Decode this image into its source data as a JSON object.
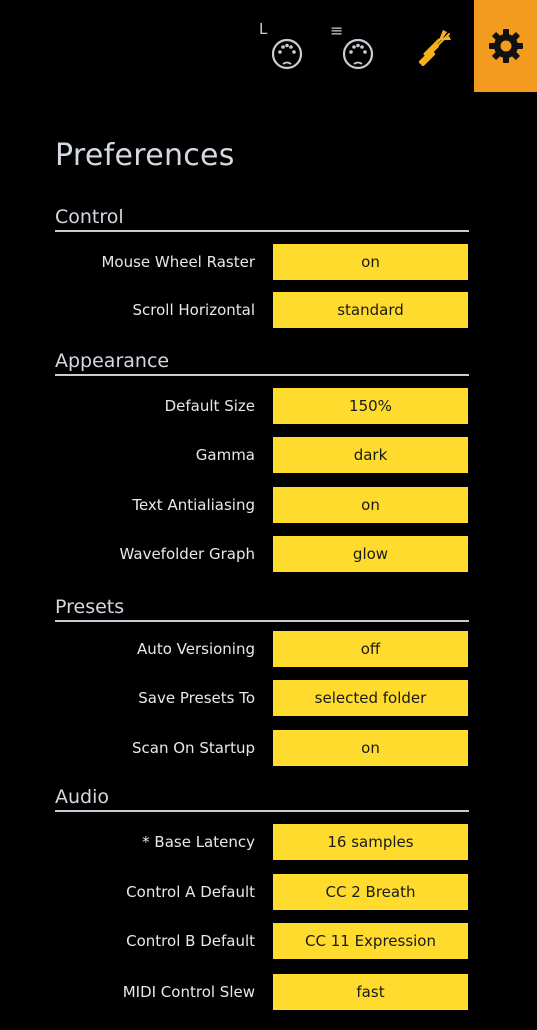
{
  "toolbar": {
    "midi_l_mark": "L",
    "midi_e_mark": "≡",
    "icons": [
      "midi-din-icon",
      "midi-din-icon",
      "tools-icon",
      "gear-icon"
    ],
    "active_color": "#f29b1f",
    "icon_color": "#c9cdd3",
    "tools_color": "#f5b21c"
  },
  "page": {
    "title": "Preferences"
  },
  "theme": {
    "value_bg": "#fedb2c",
    "background": "#000000"
  },
  "sections": [
    {
      "title": "Control",
      "rows": [
        {
          "label": "Mouse Wheel Raster",
          "value": "on"
        },
        {
          "label": "Scroll Horizontal",
          "value": "standard"
        }
      ]
    },
    {
      "title": "Appearance",
      "rows": [
        {
          "label": "Default Size",
          "value": "150%"
        },
        {
          "label": "Gamma",
          "value": "dark"
        },
        {
          "label": "Text Antialiasing",
          "value": "on"
        },
        {
          "label": "Wavefolder Graph",
          "value": "glow"
        }
      ]
    },
    {
      "title": "Presets",
      "rows": [
        {
          "label": "Auto Versioning",
          "value": "off"
        },
        {
          "label": "Save Presets To",
          "value": "selected folder"
        },
        {
          "label": "Scan On Startup",
          "value": "on"
        }
      ]
    },
    {
      "title": "Audio",
      "rows": [
        {
          "label": "* Base Latency",
          "value": "16 samples"
        },
        {
          "label": "Control A Default",
          "value": "CC 2 Breath"
        },
        {
          "label": "Control B Default",
          "value": "CC 11 Expression"
        },
        {
          "label": "MIDI Control Slew",
          "value": "fast"
        }
      ]
    }
  ]
}
